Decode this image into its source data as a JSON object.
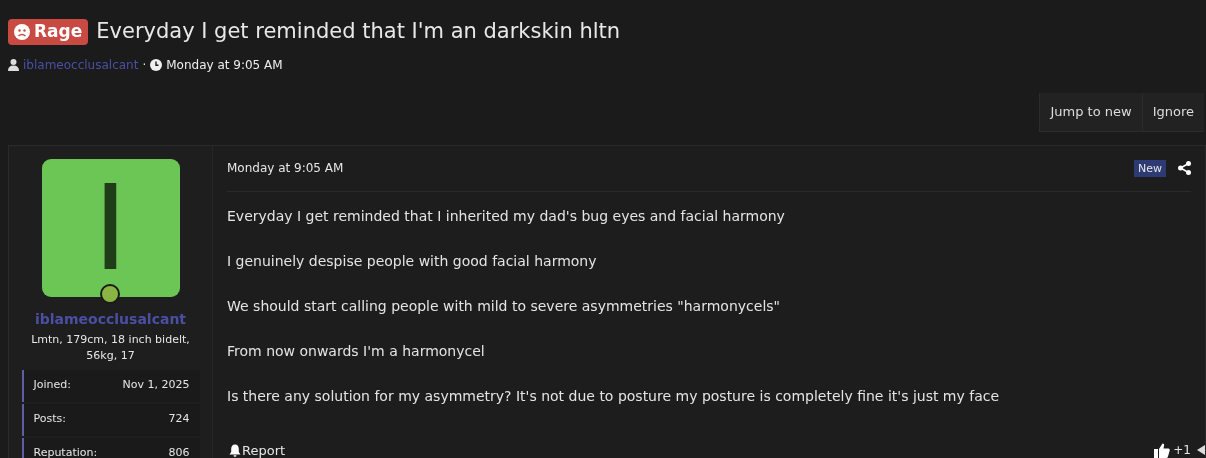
{
  "thread": {
    "prefix": {
      "label": "Rage",
      "color": "#c84a43"
    },
    "title": "Everyday I get reminded that I'm an darkskin hltn",
    "author": "iblameocclusalcant",
    "separator": "·",
    "date": "Monday at 9:05 AM"
  },
  "thread_actions": [
    "Jump to new",
    "Ignore"
  ],
  "post": {
    "user": {
      "avatar_letter": "I",
      "online": true,
      "name": "iblameocclusalcant",
      "title": "Lmtn, 179cm, 18 inch bidelt, 56kg, 17",
      "stats": [
        {
          "label": "Joined:",
          "value": "Nov 1, 2025"
        },
        {
          "label": "Posts:",
          "value": "724"
        },
        {
          "label": "Reputation:",
          "value": "806"
        }
      ]
    },
    "date": "Monday at 9:05 AM",
    "badge": "New",
    "paragraphs": [
      "Everyday I get reminded that I inherited my dad's bug eyes and facial harmony",
      "I genuinely despise people with good facial harmony",
      "We should start calling people with mild to severe asymmetries \"harmonycels\"",
      "From now onwards I'm a harmonycel",
      "Is there any solution for my asymmetry? It's not due to posture my posture is completely fine it's just my face"
    ],
    "report": "Report",
    "reaction_count": "+1"
  }
}
